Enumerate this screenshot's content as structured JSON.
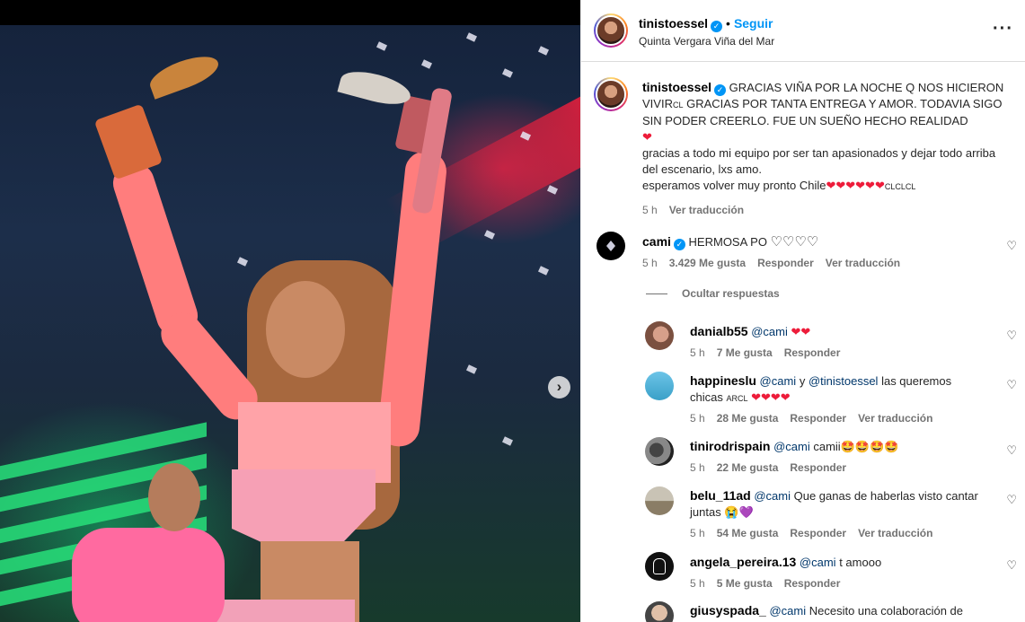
{
  "post": {
    "author": "tinistoessel",
    "follow_label": "Seguir",
    "location": "Quinta Vergara Viña del Mar",
    "more_icon": "more-options-icon",
    "next_icon": "chevron-right-icon"
  },
  "caption": {
    "username": "tinistoessel",
    "line1": "GRACIAS VIÑA POR LA NOCHE Q NOS HICIERON VIVIR",
    "flag1": "CL",
    "line1b": " GRACIAS POR TANTA ENTREGA Y AMOR. TODAVIA SIGO SIN PODER CREERLO. FUE UN SUEÑO HECHO REALIDAD",
    "heart1": "❤",
    "line2": "gracias a todo mi equipo por ser tan apasionados y dejar todo arriba del escenario, lxs amo.",
    "line3": "esperamos volver muy pronto Chile",
    "hearts3": "❤❤❤❤❤❤",
    "flags3": "CLCLCL",
    "time": "5 h",
    "translate": "Ver traducción"
  },
  "comments": [
    {
      "username": "cami",
      "text": "HERMOSA PO",
      "hearts": "♡♡♡♡",
      "time": "5 h",
      "likes": "3.429 Me gusta",
      "reply": "Responder",
      "translate": "Ver traducción"
    }
  ],
  "hide_replies": "Ocultar respuestas",
  "replies": [
    {
      "username": "danialb55",
      "mention": "@cami",
      "text": "",
      "emoji": "❤❤",
      "time": "5 h",
      "likes": "7 Me gusta",
      "reply": "Responder"
    },
    {
      "username": "happineslu",
      "mention": "@cami",
      "connector": "y",
      "mention2": "@tinistoessel",
      "text": "las queremos chicas",
      "flag": "ARCL",
      "emoji": "❤❤❤❤",
      "time": "5 h",
      "likes": "28 Me gusta",
      "reply": "Responder",
      "translate": "Ver traducción"
    },
    {
      "username": "tinirodrispain",
      "mention": "@cami",
      "text": "camii",
      "emoji": "🤩🤩🤩🤩",
      "time": "5 h",
      "likes": "22 Me gusta",
      "reply": "Responder"
    },
    {
      "username": "belu_11ad",
      "mention": "@cami",
      "text": "Que ganas de haberlas visto cantar juntas",
      "emoji": "😭💜",
      "time": "5 h",
      "likes": "54 Me gusta",
      "reply": "Responder",
      "translate": "Ver traducción"
    },
    {
      "username": "angela_pereira.13",
      "mention": "@cami",
      "text": "t amooo",
      "emoji": "",
      "time": "5 h",
      "likes": "5 Me gusta",
      "reply": "Responder"
    },
    {
      "username": "giusyspada_",
      "mention": "@cami",
      "text": "Necesito una colaboración de",
      "emoji": ""
    }
  ],
  "like_icon": "♡"
}
